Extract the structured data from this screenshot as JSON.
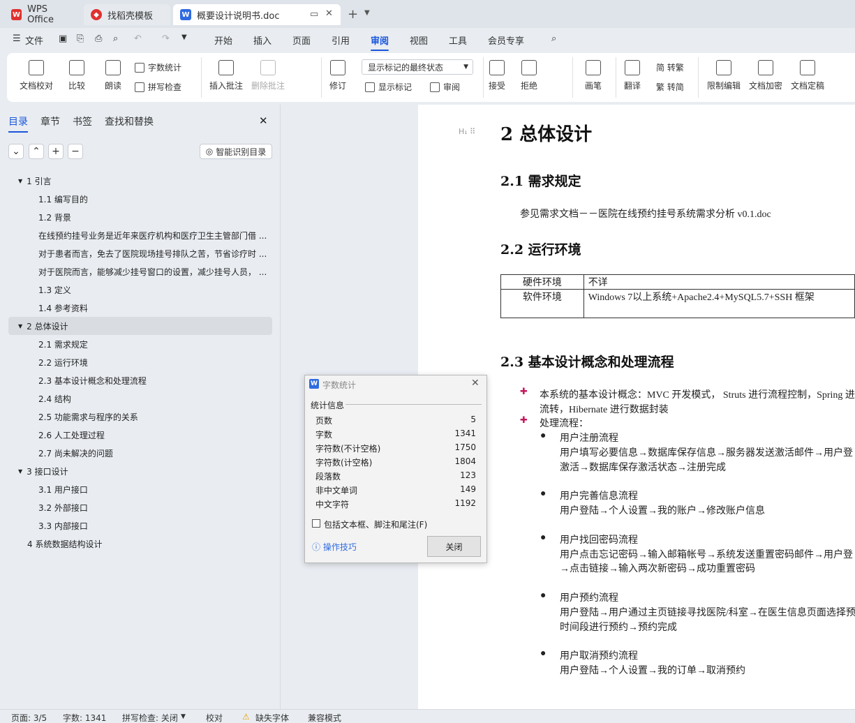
{
  "tabs": [
    {
      "label": "WPS Office"
    },
    {
      "label": "找稻壳模板"
    },
    {
      "label": "概要设计说明书.doc"
    }
  ],
  "menu": {
    "file": "文件",
    "items": [
      "开始",
      "插入",
      "页面",
      "引用",
      "审阅",
      "视图",
      "工具",
      "会员专享"
    ]
  },
  "ribbon": {
    "doc_check": "文档校对",
    "compare": "比较",
    "read": "朗读",
    "word_count": "字数统计",
    "spell": "拼写检查",
    "insert_comment": "插入批注",
    "delete_comment": "删除批注",
    "track": "修订",
    "display_select": "显示标记的最终状态",
    "show_markup": "显示标记",
    "review": "审阅",
    "accept": "接受",
    "reject": "拒绝",
    "pen": "画笔",
    "translate": "翻译",
    "to_trad": "简 转繁",
    "to_simp": "繁 转简",
    "restrict": "限制编辑",
    "encrypt": "文档加密",
    "finalize": "文档定稿"
  },
  "sidebar": {
    "tabs": [
      "目录",
      "章节",
      "书签",
      "查找和替换"
    ],
    "smart_btn": "智能识别目录",
    "toc": [
      "1 引言",
      "1.1 编写目的",
      "1.2 背景",
      "在线预约挂号业务是近年来医疗机构和医疗卫生主管部门借 ...",
      "对于患者而言，免去了医院现场挂号排队之苦，节省诊疗时 ...",
      "对于医院而言，能够减少挂号窗口的设置，减少挂号人员， ...",
      "1.3 定义",
      "1.4 参考资料",
      "2 总体设计",
      "2.1 需求规定",
      "2.2 运行环境",
      "2.3 基本设计概念和处理流程",
      "2.4 结构",
      "2.5 功能需求与程序的关系",
      "2.6 人工处理过程",
      "2.7 尚未解决的问题",
      "3 接口设计",
      "3.1 用户接口",
      "3.2 外部接口",
      "3.3 内部接口",
      "4 系统数据结构设计"
    ]
  },
  "doc": {
    "h1": "2 总体设计",
    "h2_1": "2.1 需求规定",
    "p1": "参见需求文档－－医院在线预约挂号系统需求分析 v0.1.doc",
    "h2_2": "2.2 运行环境",
    "table": [
      [
        "硬件环境",
        "不详"
      ],
      [
        "软件环境",
        "Windows 7以上系统+Apache2.4+MySQL5.7+SSH 框架"
      ]
    ],
    "h2_3": "2.3 基本设计概念和处理流程",
    "b1a": "本系统的基本设计概念：MVC 开发模式， Struts 进行流程控制，Spring 进",
    "b1b": "流转，Hibernate 进行数据封装",
    "b2": "处理流程：",
    "flows": [
      {
        "title": "用户注册流程",
        "l1": "用户填写必要信息→数据库保存信息→服务器发送激活邮件→用户登",
        "l2": "激活→数据库保存激活状态→注册完成"
      },
      {
        "title": "用户完善信息流程",
        "l1": "用户登陆→个人设置→我的账户→修改账户信息",
        "l2": ""
      },
      {
        "title": "用户找回密码流程",
        "l1": "用户点击忘记密码→输入邮箱帐号→系统发送重置密码邮件→用户登",
        "l2": "→点击链接→输入两次新密码→成功重置密码"
      },
      {
        "title": "用户预约流程",
        "l1": "用户登陆→用户通过主页链接寻找医院/科室→在医生信息页面选择预",
        "l2": "时间段进行预约→预约完成"
      },
      {
        "title": "用户取消预约流程",
        "l1": "用户登陆→个人设置→我的订单→取消预约",
        "l2": ""
      }
    ]
  },
  "dialog": {
    "title": "字数统计",
    "section": "统计信息",
    "rows": [
      [
        "页数",
        "5"
      ],
      [
        "字数",
        "1341"
      ],
      [
        "字符数(不计空格)",
        "1750"
      ],
      [
        "字符数(计空格)",
        "1804"
      ],
      [
        "段落数",
        "123"
      ],
      [
        "非中文单词",
        "149"
      ],
      [
        "中文字符",
        "1192"
      ]
    ],
    "checkbox": "包括文本框、脚注和尾注(F)",
    "tips": "操作技巧",
    "close": "关闭"
  },
  "status": {
    "page": "页面: 3/5",
    "words": "字数: 1341",
    "spell": "拼写检查: 关闭",
    "proof": "校对",
    "font": "缺失字体",
    "compat": "兼容模式"
  },
  "colors": {
    "accent": "#1a56db",
    "wps_red": "#e0312f",
    "doc_blue": "#2f6be0"
  }
}
